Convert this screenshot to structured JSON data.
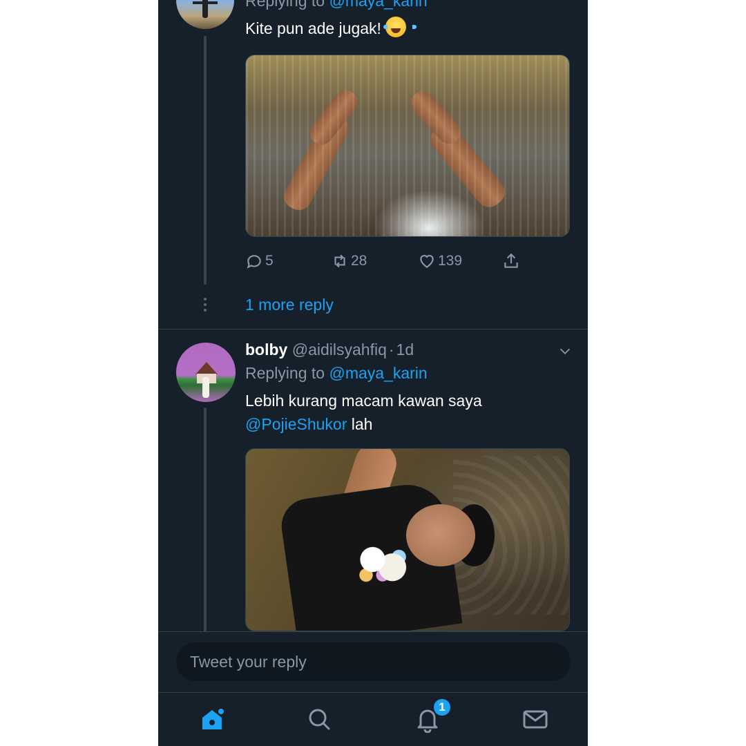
{
  "colors": {
    "background": "#15202b",
    "accent": "#1da1f2",
    "muted": "#8899a6",
    "border": "#38444d"
  },
  "tweet1": {
    "reply_prefix": "Replying to",
    "reply_mention": "@maya_karin",
    "text": "Kite pun ade jugak!",
    "emoji": "face-with-tears-of-joy",
    "stats": {
      "replies": "5",
      "retweets": "28",
      "likes": "139"
    },
    "more_replies": "1 more reply"
  },
  "tweet2": {
    "name": "bolby",
    "handle": "@aidilsyahfiq",
    "separator": "·",
    "time": "1d",
    "reply_prefix": "Replying to",
    "reply_mention": "@maya_karin",
    "text_line1": "Lebih kurang macam kawan saya",
    "text_mention": "@PojieShukor",
    "text_tail": "lah"
  },
  "reply_bar": {
    "placeholder": "Tweet your reply"
  },
  "tabbar": {
    "tabs": [
      "home-icon",
      "search-icon",
      "notifications-icon",
      "messages-icon"
    ],
    "notification_count": "1"
  }
}
